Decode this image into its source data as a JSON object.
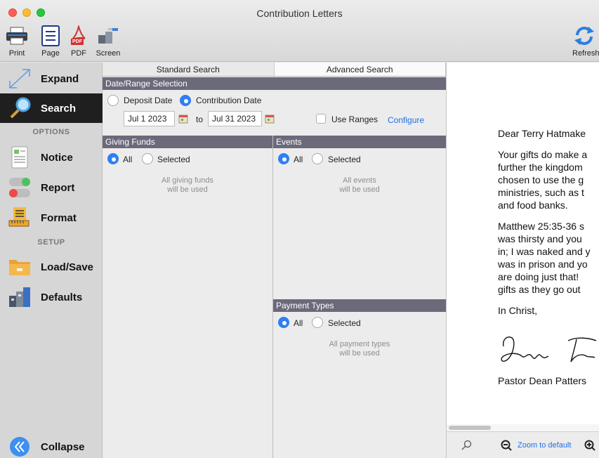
{
  "window": {
    "title": "Contribution Letters"
  },
  "toolbar": {
    "print": "Print",
    "page": "Page",
    "pdf": "PDF",
    "pdf_badge": "PDF",
    "screen": "Screen",
    "refresh": "Refresh"
  },
  "sidebar": {
    "expand": "Expand",
    "search": "Search",
    "options_heading": "OPTIONS",
    "notice": "Notice",
    "report": "Report",
    "format": "Format",
    "setup_heading": "SETUP",
    "load_save": "Load/Save",
    "defaults": "Defaults",
    "collapse": "Collapse"
  },
  "tabs": {
    "standard": "Standard Search",
    "advanced": "Advanced Search"
  },
  "date_range": {
    "heading": "Date/Range Selection",
    "deposit_date": "Deposit Date",
    "contribution_date": "Contribution Date",
    "selected_mode": "contribution",
    "from": "Jul 1 2023",
    "to_label": "to",
    "to": "Jul 31 2023",
    "use_ranges": "Use Ranges",
    "use_ranges_checked": false,
    "configure": "Configure"
  },
  "giving_funds": {
    "heading": "Giving Funds",
    "all": "All",
    "selected": "Selected",
    "note_line1": "All giving funds",
    "note_line2": "will be used"
  },
  "events": {
    "heading": "Events",
    "all": "All",
    "selected": "Selected",
    "note_line1": "All events",
    "note_line2": "will be used"
  },
  "payment_types": {
    "heading": "Payment Types",
    "all": "All",
    "selected": "Selected",
    "note_line1": "All payment types",
    "note_line2": "will be used"
  },
  "preview": {
    "greeting": "Dear Terry Hatmake",
    "para1": [
      "Your gifts do make a",
      "further the kingdom",
      "chosen to use the g",
      "ministries, such as t",
      "and food banks."
    ],
    "para2": [
      "Matthew 25:35-36 s",
      "was thirsty and you",
      "in; I was naked and y",
      "was in prison and yo",
      "are doing just that!",
      "gifts as they go out"
    ],
    "closing": "In Christ,",
    "signer": "Pastor Dean Patters",
    "zoom_default": "Zoom to default"
  },
  "colors": {
    "section_header": "#6b6a7b",
    "radio_selected": "#2f7ff3",
    "link": "#1f6fe6",
    "sidebar_active": "#1f1f1f"
  }
}
